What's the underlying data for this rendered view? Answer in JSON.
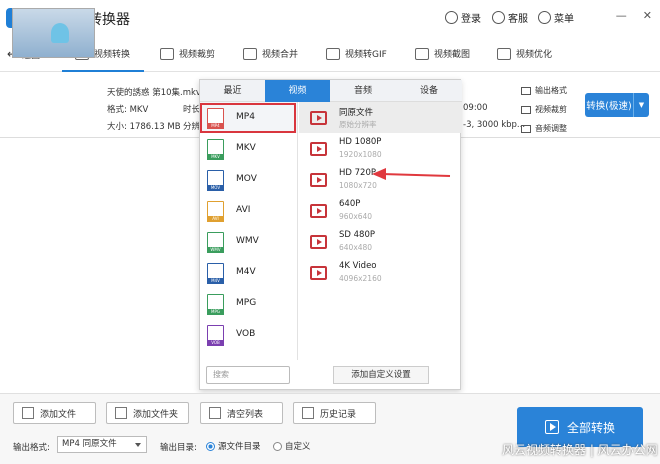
{
  "titlebar": {
    "app_title": "风云视频转换器",
    "login": "登录",
    "support": "客服",
    "menu": "菜单",
    "min": "—",
    "close": "✕"
  },
  "toolbar": {
    "back": "返回",
    "tabs": [
      "视频转换",
      "视频裁剪",
      "视频合并",
      "视频转GIF",
      "视频截图",
      "视频优化"
    ]
  },
  "file": {
    "name": "天使的誘惑 第10集.mkv",
    "format": "格式: MKV",
    "duration_label": "时长",
    "size": "大小: 1786.13 MB",
    "ratio_label": "分辨",
    "time_end": "09:00",
    "bitrate_end": "-3, 3000 kbp...",
    "output_format_link": "输出格式",
    "crop_link": "视频裁剪",
    "adjust_link": "音频调整",
    "convert_button": "转换(极速)",
    "dropdown_arrow": "▼"
  },
  "popup": {
    "tabs": [
      "最近",
      "视频",
      "音频",
      "设备"
    ],
    "formats": [
      {
        "name": "MP4",
        "tag": "MP4",
        "color": "#d9534f"
      },
      {
        "name": "MKV",
        "tag": "MKV",
        "color": "#3a9d5d"
      },
      {
        "name": "MOV",
        "tag": "MOV",
        "color": "#2a5fa8"
      },
      {
        "name": "AVI",
        "tag": "AVI",
        "color": "#e0a030"
      },
      {
        "name": "WMV",
        "tag": "WMV",
        "color": "#3a9d5d"
      },
      {
        "name": "M4V",
        "tag": "M4V",
        "color": "#2a5fa8"
      },
      {
        "name": "MPG",
        "tag": "MPG",
        "color": "#3a9d5d"
      },
      {
        "name": "VOB",
        "tag": "VOB",
        "color": "#7b3fb0"
      }
    ],
    "qualities": [
      {
        "name": "同原文件",
        "sub": "原始分辨率"
      },
      {
        "name": "HD 1080P",
        "sub": "1920x1080"
      },
      {
        "name": "HD 720P",
        "sub": "1080x720"
      },
      {
        "name": "640P",
        "sub": "960x640"
      },
      {
        "name": "SD 480P",
        "sub": "640x480"
      },
      {
        "name": "4K Video",
        "sub": "4096x2160"
      }
    ],
    "search_placeholder": "搜索",
    "custom_button": "添加自定义设置"
  },
  "bottom": {
    "buttons": [
      "添加文件",
      "添加文件夹",
      "清空列表",
      "历史记录"
    ],
    "output_format_label": "输出格式:",
    "output_format_value": "MP4 同原文件",
    "output_dir_label": "输出目录:",
    "radio_source": "源文件目录",
    "radio_custom": "自定义",
    "convert_all": "全部转换",
    "watermark": "风云视频转换器 | 风云办公网"
  },
  "colors": {
    "accent": "#2a83d8",
    "highlight": "#d9363e"
  }
}
